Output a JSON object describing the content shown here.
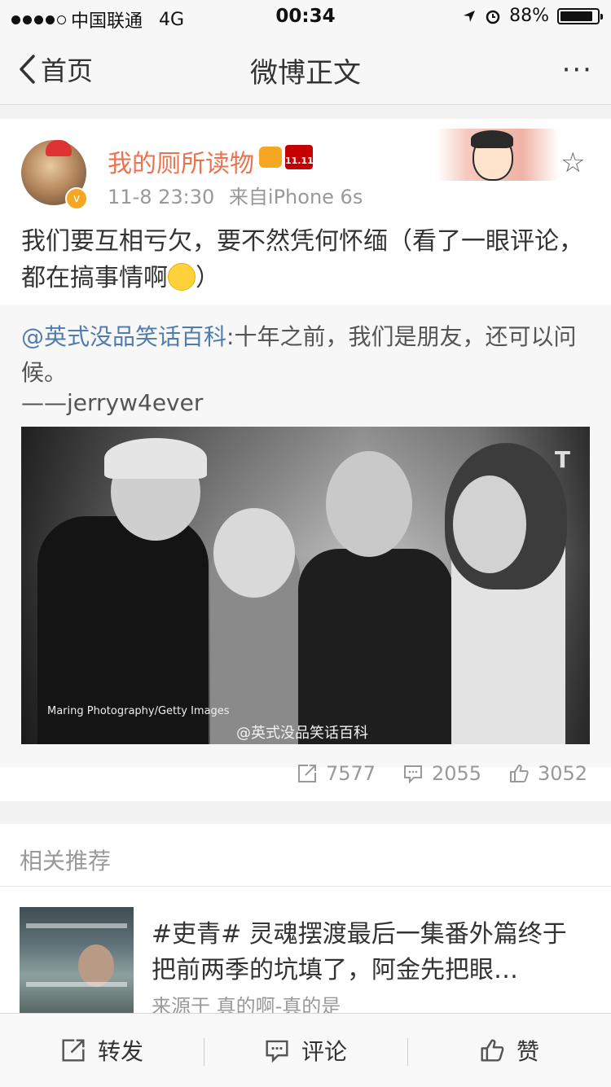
{
  "status": {
    "carrier": "中国联通",
    "network": "4G",
    "time": "00:34",
    "battery_text": "88%",
    "battery_level": 0.88
  },
  "nav": {
    "back_label": "首页",
    "title": "微博正文",
    "more": "···"
  },
  "post": {
    "author": "我的厕所读物",
    "time": "11-8 23:30",
    "source": "来自iPhone 6s",
    "text": "我们要互相亏欠，要不然凭何怀缅（看了一眼评论，都在搞事情啊",
    "text_end": "）",
    "repost": {
      "mention": "@英式没品笑话百科",
      "text": ":十年之前，我们是朋友，还可以问候。",
      "signature": "——jerryw4ever",
      "image_caption": "Maring Photography/Getty Images",
      "image_watermark": "@英式没品笑话百科"
    },
    "reposts": "7577",
    "comments": "2055",
    "likes": "3052"
  },
  "related": {
    "header": "相关推荐",
    "items": [
      {
        "title": "#吏青#  灵魂摆渡最后一集番外篇终于把前两季的坑填了，阿金先把眼…",
        "source": "来源于 真的啊-真的是"
      }
    ]
  },
  "toolbar": {
    "repost_label": "转发",
    "comment_label": "评论",
    "like_label": "赞"
  },
  "colors": {
    "author": "#eb7350",
    "mention": "#507daf",
    "meta": "#999999"
  }
}
